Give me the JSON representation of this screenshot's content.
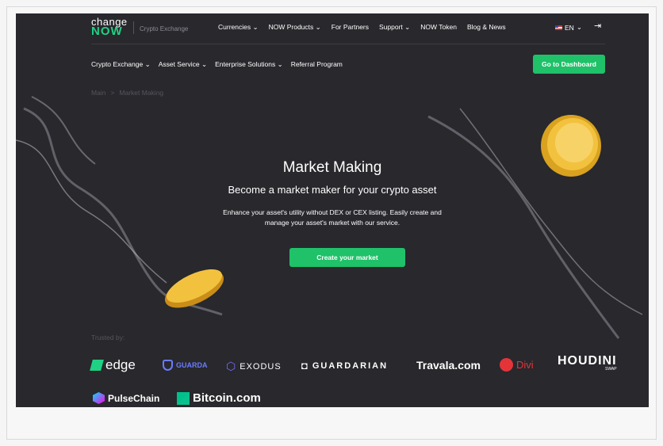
{
  "header": {
    "logo_line1": "change",
    "logo_line2": "NOW",
    "logo_sub": "Crypto Exchange",
    "nav": [
      "Currencies ⌄",
      "NOW Products ⌄",
      "For Partners",
      "Support ⌄",
      "NOW Token",
      "Blog & News"
    ],
    "lang": "EN",
    "dashboard_button": "Go to Dashboard"
  },
  "subnav": [
    "Crypto Exchange ⌄",
    "Asset Service ⌄",
    "Enterprise Solutions ⌄",
    "Referral Program"
  ],
  "breadcrumbs": {
    "root": "Main",
    "sep": ">",
    "current": "Market Making"
  },
  "hero": {
    "title": "Market Making",
    "subtitle": "Become a market maker for your crypto asset",
    "description": "Enhance your asset's utility without DEX or CEX listing. Easily create and manage your asset's market with our service.",
    "cta": "Create your market"
  },
  "trusted": {
    "label": "Trusted by:",
    "brands": [
      "edge",
      "GUARDA",
      "EXODUS",
      "GUARDARIAN",
      "Travala.com",
      "Divi",
      "HOUDINI",
      "SWAP",
      "PulseChain",
      "Bitcoin.com"
    ]
  },
  "colors": {
    "accent": "#1fc169",
    "background": "#28282d",
    "logo_green": "#1fd283"
  }
}
